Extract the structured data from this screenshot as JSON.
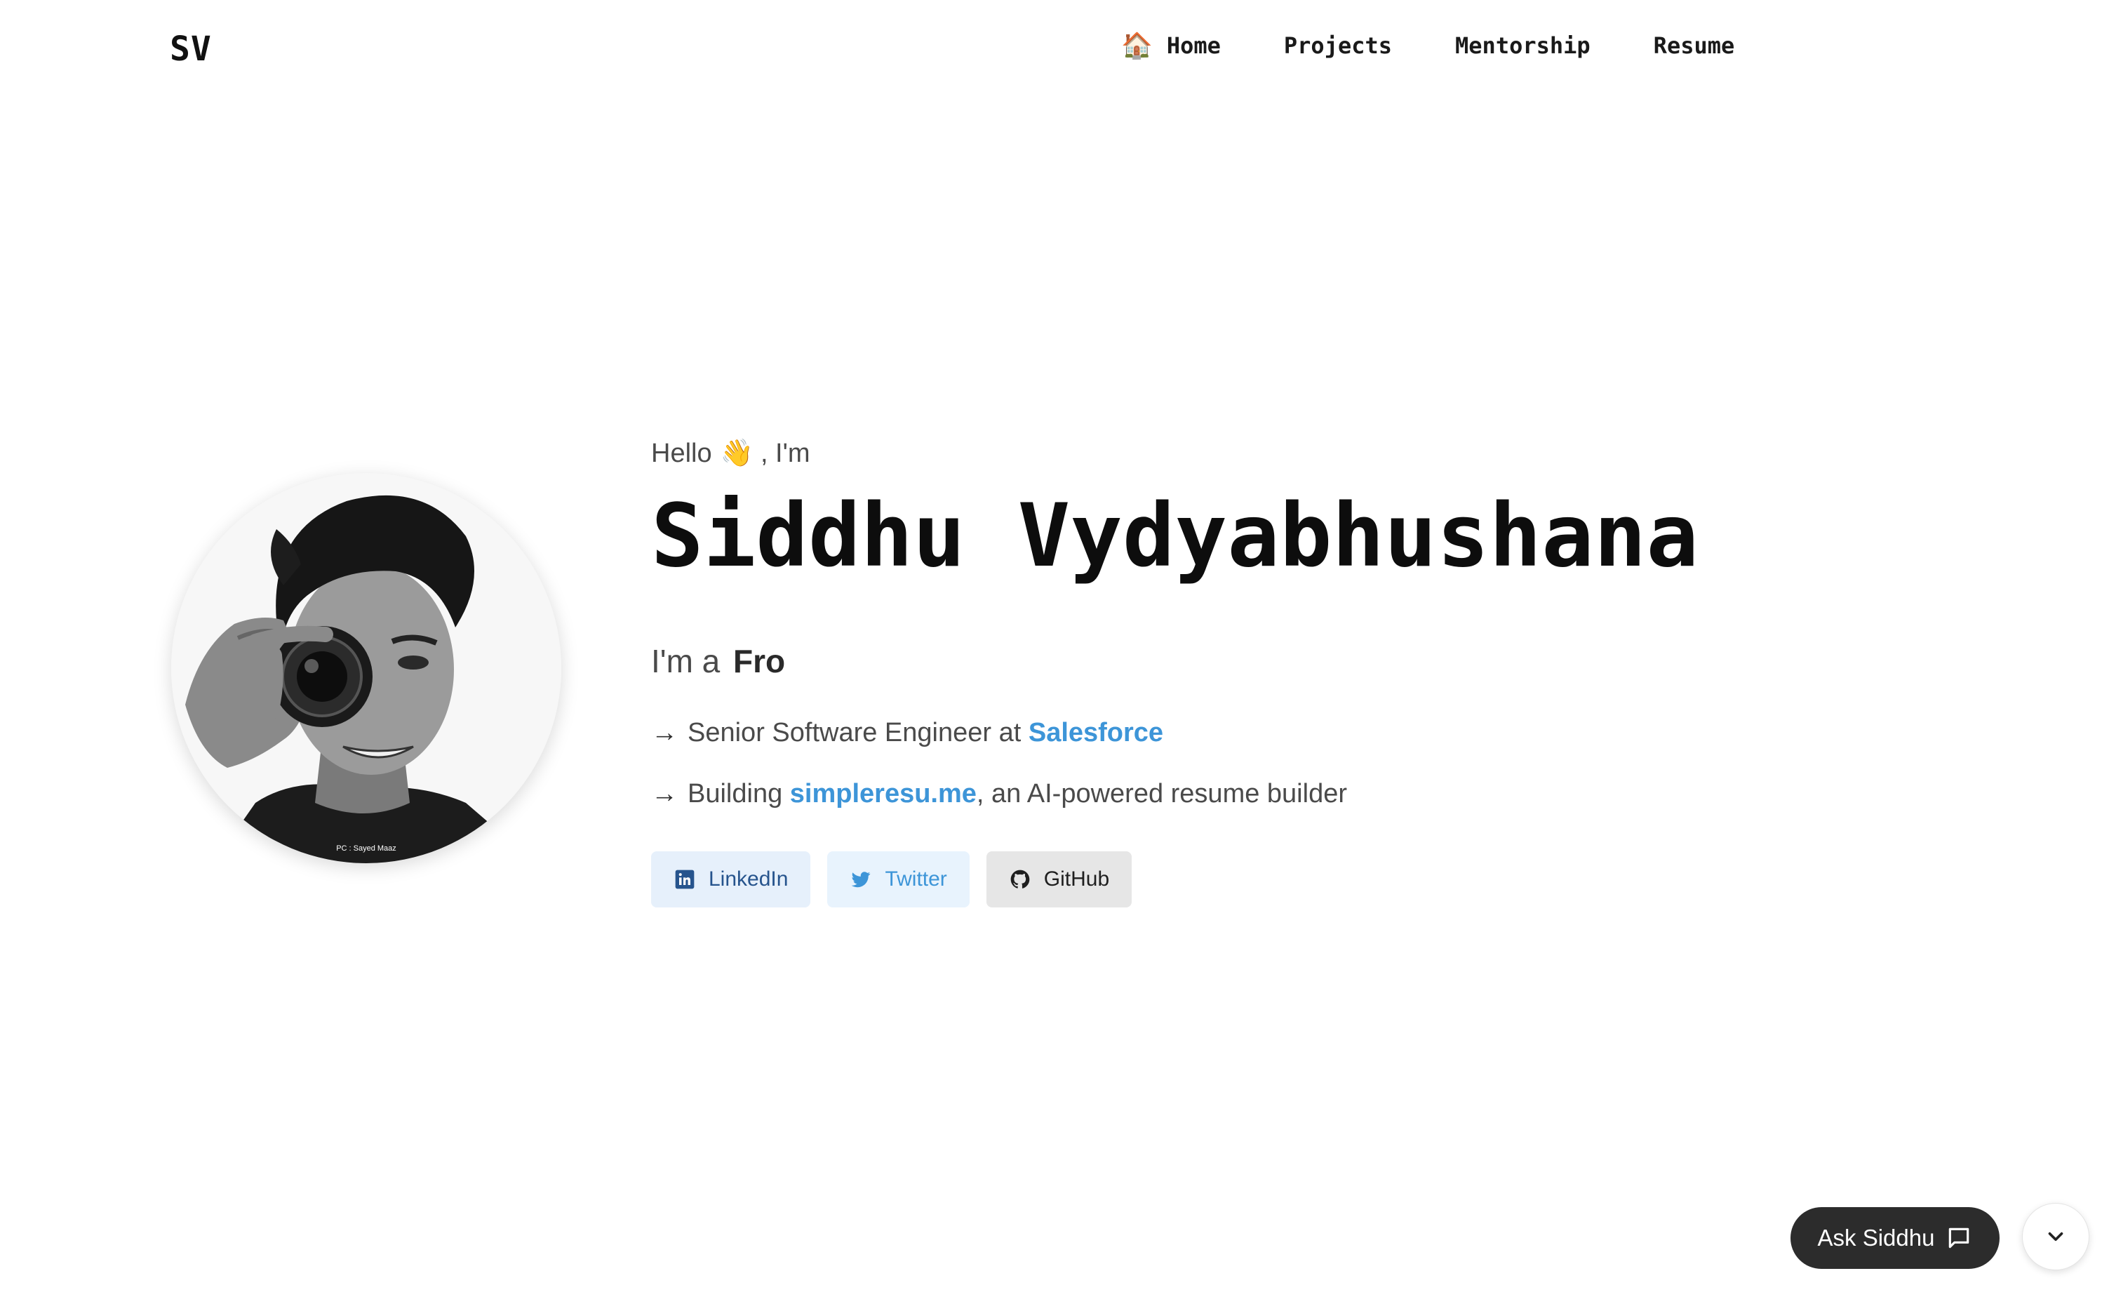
{
  "nav": {
    "logo": "SV",
    "items": [
      {
        "label": "Home",
        "emoji": "🏠"
      },
      {
        "label": "Projects"
      },
      {
        "label": "Mentorship"
      },
      {
        "label": "Resume"
      }
    ]
  },
  "hero": {
    "greeting_prefix": "Hello",
    "greeting_emoji": "👋",
    "greeting_suffix": ", I'm",
    "name": "Siddhu Vydyabhushana",
    "role_prefix": "I'm a",
    "role_typed": "Fro",
    "photo_credit": "PC : Sayed Maaz",
    "bullets": [
      {
        "arrow": "→",
        "text_before": "Senior Software Engineer at",
        "link_text": "Salesforce",
        "text_after": ""
      },
      {
        "arrow": "→",
        "text_before": "Building",
        "link_text": "simpleresu.me",
        "text_after": ", an AI-powered resume builder"
      }
    ]
  },
  "socials": [
    {
      "label": "LinkedIn",
      "icon": "linkedin-icon"
    },
    {
      "label": "Twitter",
      "icon": "twitter-icon"
    },
    {
      "label": "GitHub",
      "icon": "github-icon"
    }
  ],
  "chat": {
    "ask_label": "Ask Siddhu",
    "ask_icon": "chat-bubble-icon",
    "scroll_icon": "chevron-down-icon"
  },
  "colors": {
    "link": "#3d95d8",
    "linkedin_bg": "#e6f0fb",
    "twitter_bg": "#e8f3fd",
    "github_bg": "#e6e6e6",
    "ask_bg": "#2c2c2c"
  }
}
